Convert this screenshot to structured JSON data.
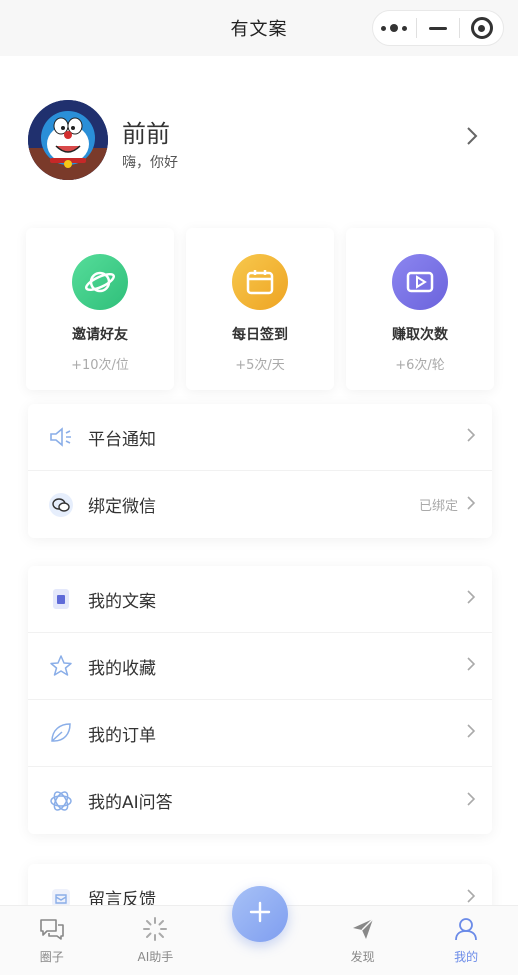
{
  "navbar": {
    "title": "有文案"
  },
  "profile": {
    "name": "前前",
    "greeting": "嗨，你好"
  },
  "stats": [
    {
      "label": "邀请好友",
      "value": "+10次/位",
      "icon": "planet-icon",
      "color": "#3ecf8e"
    },
    {
      "label": "每日签到",
      "value": "+5次/天",
      "icon": "calendar-icon",
      "color": "#f3b535"
    },
    {
      "label": "赚取次数",
      "value": "+6次/轮",
      "icon": "video-play-icon",
      "color": "#7b76e6"
    }
  ],
  "group1": [
    {
      "label": "平台通知",
      "icon": "speaker-icon",
      "extra": ""
    },
    {
      "label": "绑定微信",
      "icon": "wechat-icon",
      "extra": "已绑定"
    }
  ],
  "group2": [
    {
      "label": "我的文案",
      "icon": "document-icon"
    },
    {
      "label": "我的收藏",
      "icon": "star-icon"
    },
    {
      "label": "我的订单",
      "icon": "leaf-icon"
    },
    {
      "label": "我的AI问答",
      "icon": "openai-icon"
    }
  ],
  "group3": [
    {
      "label": "留言反馈",
      "icon": "feedback-icon"
    }
  ],
  "tabbar": [
    {
      "label": "圈子",
      "icon": "chat-bubbles-icon"
    },
    {
      "label": "AI助手",
      "icon": "loading-spinner-icon"
    },
    {
      "label": "发现",
      "icon": "paper-plane-icon"
    },
    {
      "label": "我的",
      "icon": "user-icon"
    }
  ],
  "colors": {
    "accent": "#6b8be8",
    "fab_start": "#a7c1f6",
    "fab_end": "#7f9ef0"
  }
}
